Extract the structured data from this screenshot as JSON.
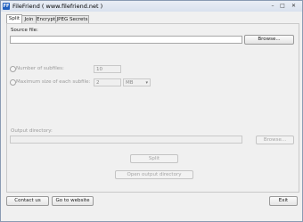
{
  "window": {
    "title": "FileFriend ( www.filefriend.net )",
    "icon_text": "FF",
    "controls": {
      "minimize": "–",
      "maximize": "□",
      "close": "✕"
    }
  },
  "tabs": [
    {
      "label": "Split"
    },
    {
      "label": "Join"
    },
    {
      "label": "Encrypt"
    },
    {
      "label": "JPEG Secrets"
    }
  ],
  "split": {
    "source_file_label": "Source file:",
    "source_file_value": "",
    "browse_label": "Browse...",
    "num_subfiles_label": "Number of subfiles:",
    "num_subfiles_value": "10",
    "max_size_label": "Maximum size of each subfile:",
    "max_size_value": "2",
    "size_unit": "MB",
    "output_dir_label": "Output directory:",
    "output_dir_value": "",
    "output_browse_label": "Browse...",
    "split_button": "Split",
    "open_output_button": "Open output directory"
  },
  "footer": {
    "contact_label": "Contact us",
    "website_label": "Go to website",
    "exit_label": "Exit"
  }
}
